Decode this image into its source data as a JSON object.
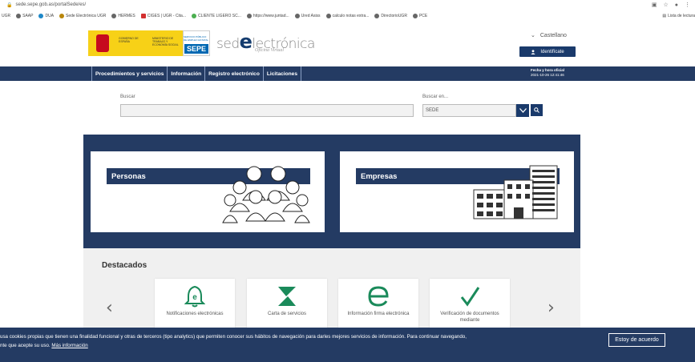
{
  "browser": {
    "url": "sede.sepe.gob.as/portalSede/es/",
    "bookmarks": [
      "UGR",
      "SAAP",
      "DUA",
      "Sede Electrónica UGR",
      "HERMES",
      "CIGES | UGR - Cita...",
      "CLIENTE LIGERO SC...",
      "https://www.juntad...",
      "Ured Asiss",
      "calculo notas extra...",
      "DirectorioUGR",
      "PCE"
    ],
    "reading_list": "Lista de lectura"
  },
  "header": {
    "gov_text": "GOBIERNO DE ESPAÑA",
    "ministry_text": "MINISTERIO DE TRABAJO Y ECONOMÍA SOCIAL",
    "sepe_small": "SERVICIO PÚBLICO DE EMPLEO ESTATAL",
    "sepe_label": "SEPE",
    "sede_before": "sed",
    "sede_e": "e",
    "sede_after": "lectrónica",
    "sede_sub": "Oficina Virtual",
    "language": "Castellano",
    "login_button": "Identifícate"
  },
  "nav": {
    "items": [
      "Procedimientos y servicios",
      "Información",
      "Registro electrónico",
      "Licitaciones"
    ],
    "date_label": "Fecha y hora oficial",
    "date_value": "2021-10-26  12:41:46"
  },
  "search": {
    "label": "Buscar",
    "value": "",
    "in_label": "Buscar en...",
    "in_value": "SEDE"
  },
  "profiles": {
    "personas": "Personas",
    "empresas": "Empresas"
  },
  "destacados": {
    "title": "Destacados",
    "items": [
      {
        "label": "Notificaciones electrónicas",
        "icon": "notification-bell-icon"
      },
      {
        "label": "Carta de servicios",
        "icon": "carta-servicios-icon"
      },
      {
        "label": "Información firma electrónica",
        "icon": "firma-electronica-icon"
      },
      {
        "label": "Verificación de documentos mediante",
        "icon": "check-icon"
      }
    ]
  },
  "cookies": {
    "line1": "usa cookies propias que tienen una finalidad funcional y otras de terceros (tipo analytics) que permiten conocer sus hábitos de navegación para darles mejores servicios de información. Para continuar navegando,",
    "line2": "nte que acepte su uso.",
    "more": "Más información",
    "accept": "Estoy de acuerdo"
  },
  "colors": {
    "navy": "#243b63",
    "button": "#1a3a6b",
    "gov_yellow": "#f7d117"
  }
}
